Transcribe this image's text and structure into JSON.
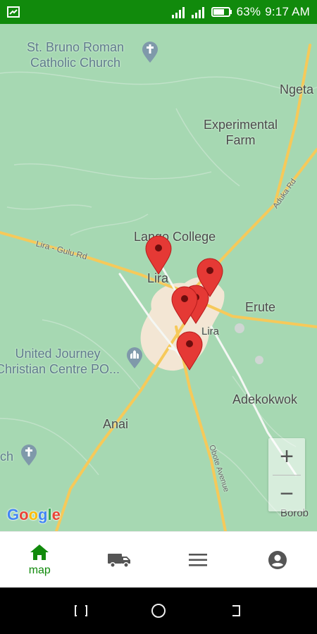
{
  "status_bar": {
    "battery_percent": "63%",
    "time": "9:17 AM",
    "icons": [
      "screenshot-icon",
      "signal-icon",
      "signal-icon",
      "battery-icon"
    ]
  },
  "map": {
    "labels": {
      "st_bruno": "St. Bruno Roman\nCatholic Church",
      "ngeta": "Ngeta",
      "experimental_farm": "Experimental\nFarm",
      "lango_college": "Lango College",
      "lira_north": "Lira",
      "erute": "Erute",
      "lira_town": "Lira",
      "united_journey": "United Journey\nChristian Centre PO...",
      "adekokwok": "Adekokwok",
      "anai": "Anai",
      "church_left": "ch",
      "borob": "Borob",
      "road_lira_gulu": "Lira - Gulu Rd",
      "road_aduku": "Aduka Rd",
      "road_obote": "Obote Avenue"
    },
    "markers_count": 5,
    "zoom_in": "+",
    "zoom_out": "−",
    "attribution": "Google"
  },
  "bottom_nav": {
    "active": "map",
    "items": [
      {
        "id": "map",
        "label": "map",
        "icon": "home-icon"
      },
      {
        "id": "delivery",
        "label": "",
        "icon": "truck-icon"
      },
      {
        "id": "menu",
        "label": "",
        "icon": "menu-icon"
      },
      {
        "id": "account",
        "label": "",
        "icon": "account-icon"
      }
    ]
  },
  "colors": {
    "accent": "#118a0c",
    "map_bg": "#a6d8b2",
    "road": "#f6c95a",
    "marker": "#e53935"
  }
}
